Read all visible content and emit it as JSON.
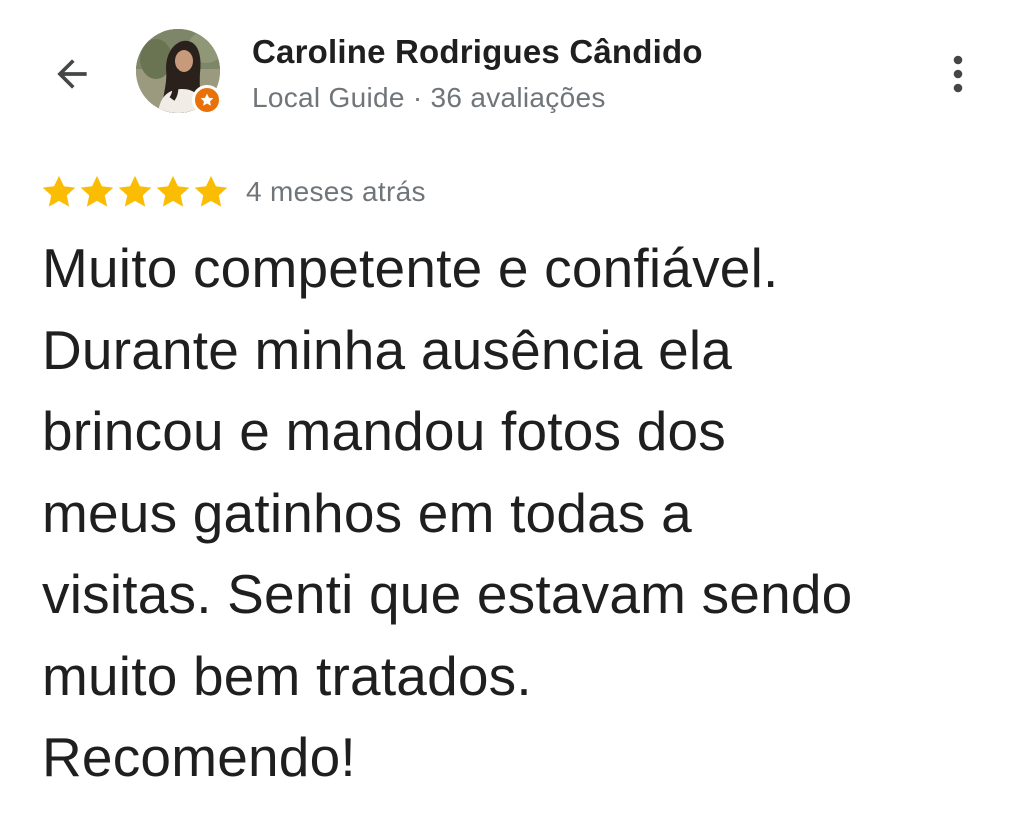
{
  "header": {
    "back_icon": "arrow-back-icon",
    "more_icon": "more-vert-icon"
  },
  "author": {
    "name": "Caroline Rodrigues Cândido",
    "meta": "Local Guide · 36 avaliações",
    "avatar": "profile-photo",
    "badge_icon": "local-guide-star-icon",
    "badge_color": "#e8710a"
  },
  "review": {
    "rating": 5,
    "max_rating": 5,
    "star_color": "#fbbc04",
    "time": "4 meses atrás",
    "text": "Muito competente e confiável.\nDurante minha ausência ela\nbrincou e mandou fotos dos\nmeus gatinhos em todas a\nvisitas. Senti que estavam sendo\nmuito bem tratados.\nRecomendo!"
  }
}
